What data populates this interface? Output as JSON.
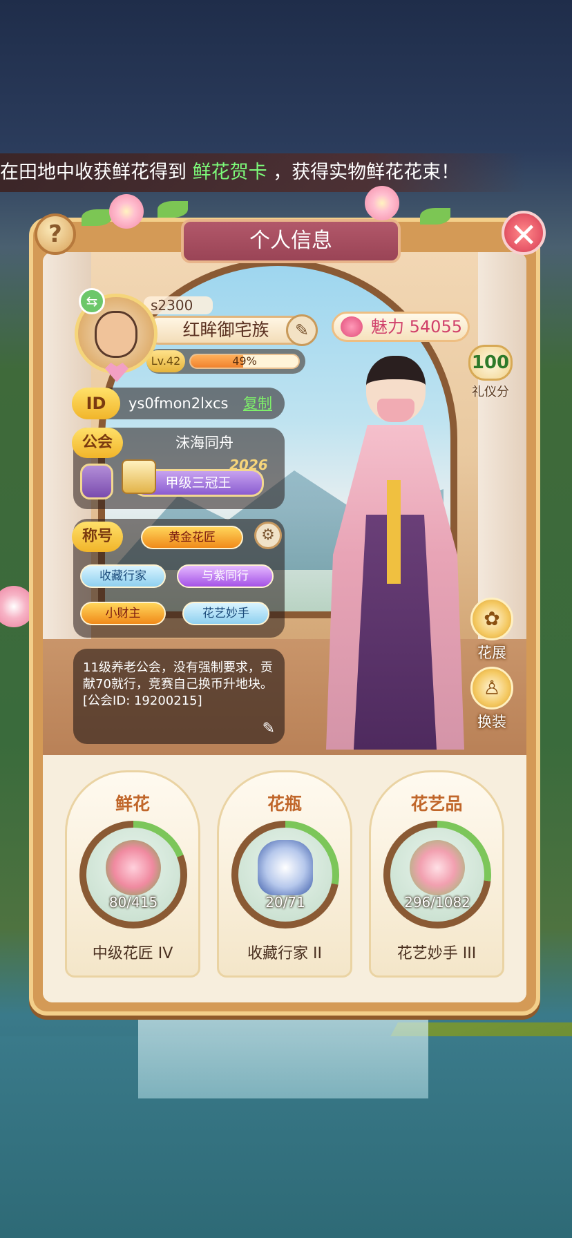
{
  "ticker": {
    "prefix": "在田地中收获鲜花得到",
    "highlight": "鲜花贺卡",
    "suffix": "，获得实物鲜花花束！"
  },
  "panel": {
    "title": "个人信息",
    "help": "?",
    "close": "✕"
  },
  "profile": {
    "score_partial": "s2300",
    "name": "红眸御宅族",
    "level_label": "Lv.42",
    "level_progress": 0.49,
    "level_progress_text": "49%",
    "charm_label": "魅力",
    "charm_value": "54055",
    "etiquette_value": "100",
    "etiquette_label": "礼仪分",
    "id_label": "ID",
    "id_value": "ys0fmon2lxcs",
    "copy_label": "复制"
  },
  "guild": {
    "label": "公会",
    "name": "沫海同舟",
    "rank": "甲级三冠王",
    "year": "2026"
  },
  "titles": {
    "label": "称号",
    "main": "黄金花匠",
    "chips": [
      "收藏行家",
      "与紫同行",
      "小财主",
      "花艺妙手"
    ]
  },
  "bio": {
    "text": "11级养老公会，没有强制要求，贡献70就行，竞赛自己换币升地块。[公会ID: 19200215]"
  },
  "side_buttons": {
    "exhibition": "花展",
    "dressup": "换装"
  },
  "collections": [
    {
      "title": "鲜花",
      "count": "80/415",
      "progress": 0.19,
      "rank": "中级花匠 IV"
    },
    {
      "title": "花瓶",
      "count": "20/71",
      "progress": 0.28,
      "rank": "收藏行家 II"
    },
    {
      "title": "花艺品",
      "count": "296/1082",
      "progress": 0.27,
      "rank": "花艺妙手 III"
    }
  ]
}
